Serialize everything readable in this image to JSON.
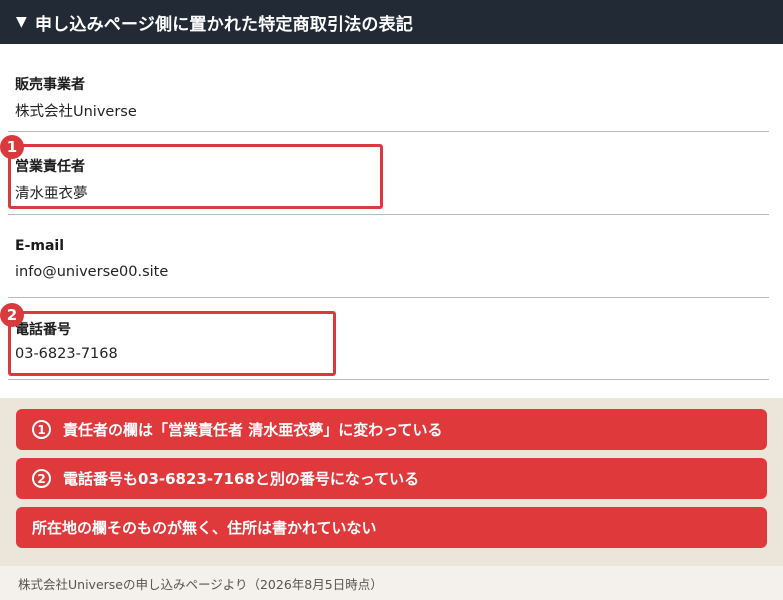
{
  "header": {
    "marker": "▼",
    "title": "申し込みページ側に置かれた特定商取引法の表記"
  },
  "fields": [
    {
      "label": "販売事業者",
      "value": "株式会社Universe"
    },
    {
      "label": "営業責任者",
      "value": "清水亜衣夢"
    },
    {
      "label": "E-mail",
      "value": "info@universe00.site"
    },
    {
      "label": "電話番号",
      "value": "03-6823-7168"
    }
  ],
  "badges": [
    "1",
    "2"
  ],
  "notes": [
    {
      "num": "1",
      "text": "責任者の欄は「営業責任者 清水亜衣夢」に変わっている"
    },
    {
      "num": "2",
      "text": "電話番号も03-6823-7168と別の番号になっている"
    },
    {
      "num": "",
      "text": "所在地の欄そのものが無く、住所は書かれていない"
    }
  ],
  "footer": {
    "text": "株式会社Universeの申し込みページより（2026年8月5日時点）"
  },
  "colors": {
    "header_bg": "#222a36",
    "accent_red": "#e0393c",
    "note_area_bg": "#ece5da"
  }
}
